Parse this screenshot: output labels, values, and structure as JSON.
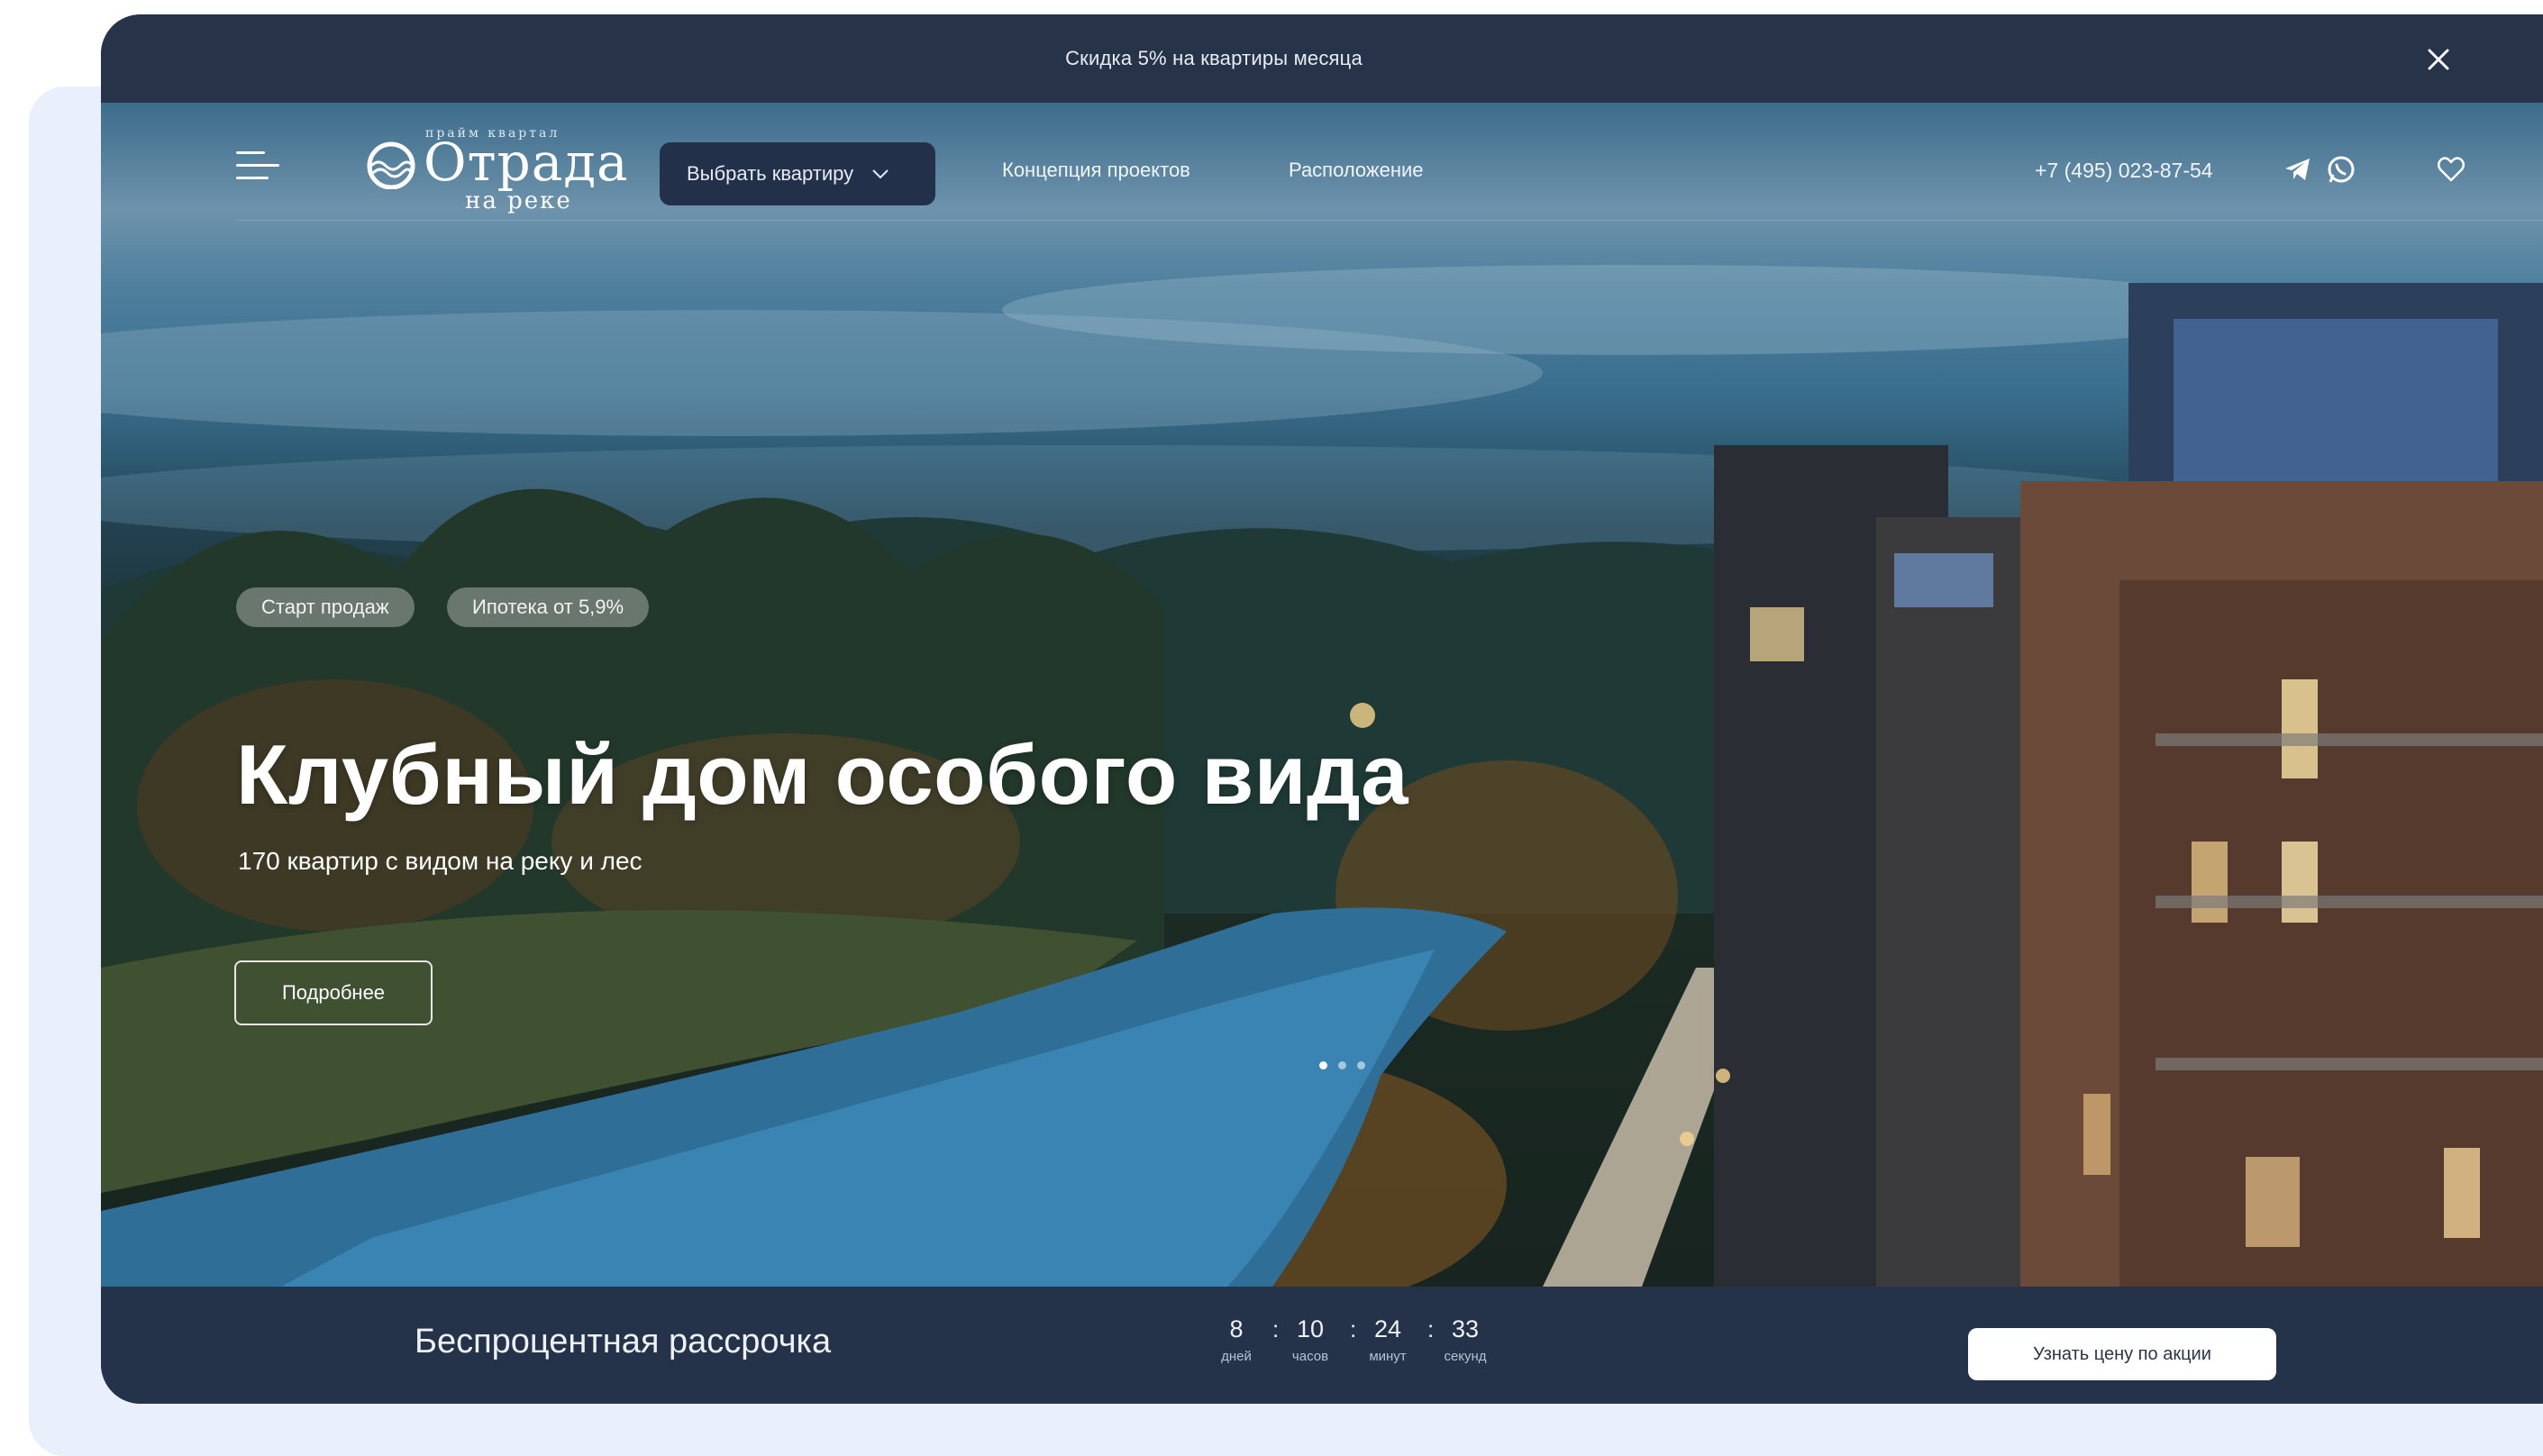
{
  "promo": {
    "text": "Скидка 5% на квартиры месяца",
    "close_icon": "close-icon"
  },
  "header": {
    "logo": {
      "top": "прайм квартал",
      "main": "Отрада",
      "sub": "на реке"
    },
    "select_label": "Выбрать квартиру",
    "nav": [
      "Концепция проектов",
      "Расположение"
    ],
    "phone": "+7 (495) 023-87-54",
    "icons": [
      "menu-icon",
      "telegram-icon",
      "whatsapp-icon",
      "heart-icon"
    ]
  },
  "hero": {
    "chips": [
      "Старт продаж",
      "Ипотека от 5,9%"
    ],
    "title": "Клубный дом особого вида",
    "subtitle": "170 квартир с видом на реку и лес",
    "more_label": "Подробнее",
    "slides": {
      "count": 3,
      "active": 1
    }
  },
  "bottom": {
    "title": "Беспроцентная рассрочка",
    "timer": [
      {
        "value": "8",
        "label": "дней"
      },
      {
        "value": "10",
        "label": "часов"
      },
      {
        "value": "24",
        "label": "минут"
      },
      {
        "value": "33",
        "label": "секунд"
      }
    ],
    "cta_label": "Узнать цену по акции"
  },
  "colors": {
    "dark_navy": "#24324a",
    "backdrop": "#e9effb",
    "accent_white": "#ffffff"
  }
}
